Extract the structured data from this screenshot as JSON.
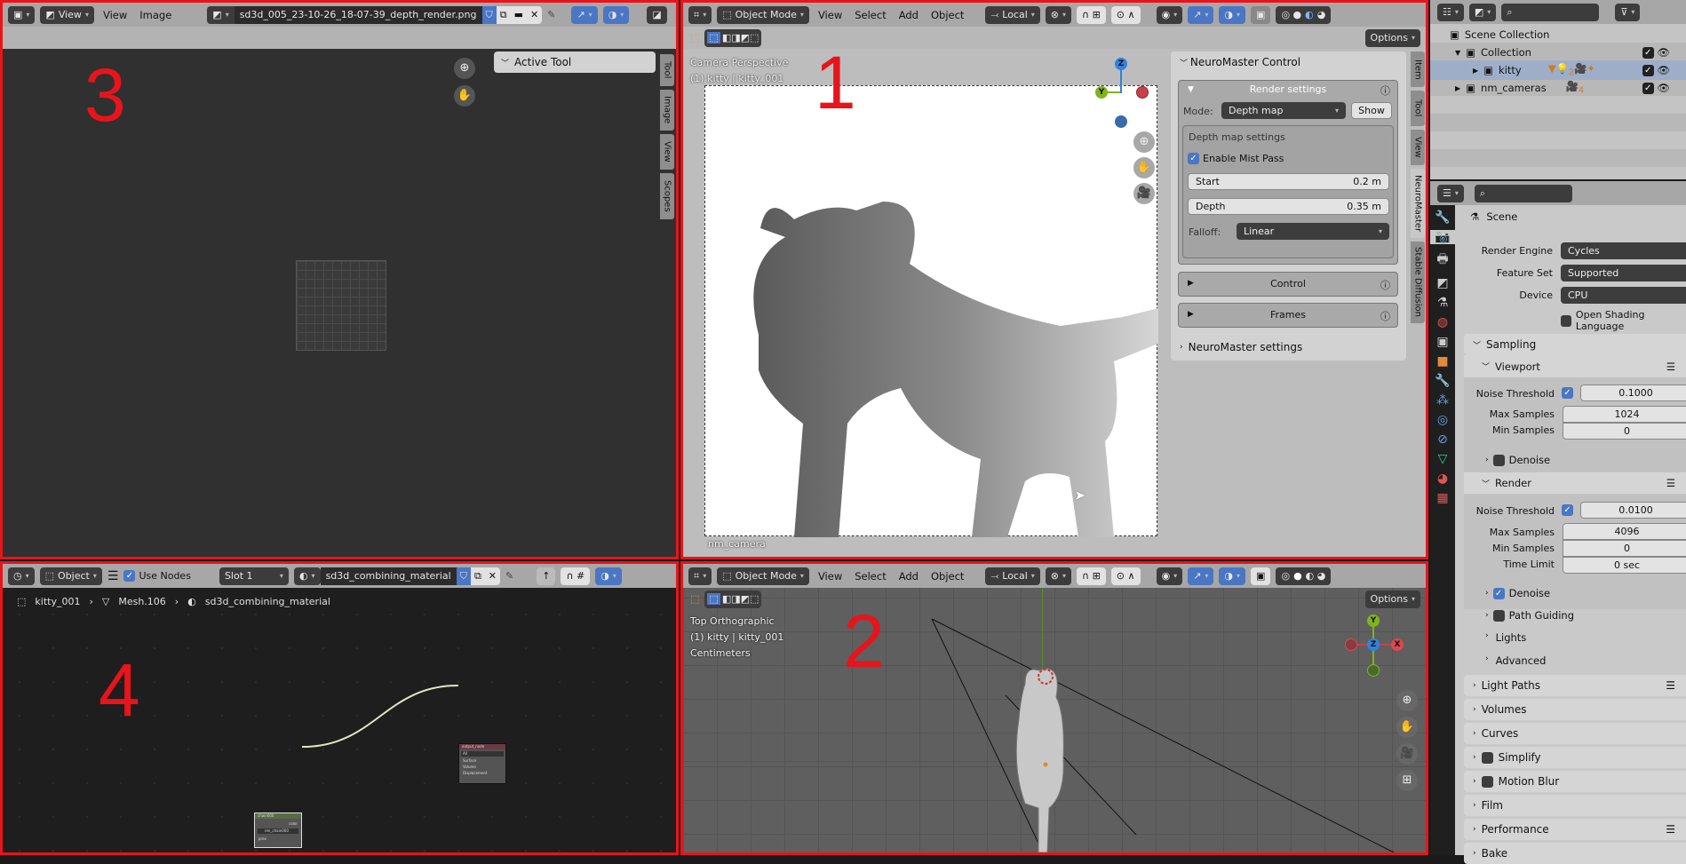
{
  "annotations": {
    "area1": "1",
    "area2": "2",
    "area3": "3",
    "area4": "4"
  },
  "image_editor": {
    "view_label": "View",
    "menus": [
      "View",
      "Image"
    ],
    "image_name": "sd3d_005_23-10-26_18-07-39_depth_render.png",
    "active_tool_title": "Active Tool",
    "side_tabs": [
      "Tool",
      "Image",
      "View",
      "Scopes"
    ]
  },
  "viewport_camera": {
    "mode": "Object Mode",
    "menus": [
      "View",
      "Select",
      "Add",
      "Object"
    ],
    "orientation": "Local",
    "options": "Options",
    "overlay_line1": "Camera Perspective",
    "overlay_line2": "(1) kitty | kitty_001",
    "camera_name": "nm_camera",
    "gizmo": {
      "z": "Z",
      "y": "Y"
    },
    "side_tabs": [
      "Item",
      "Tool",
      "View",
      "NeuroMaster",
      "Stable Diffusion"
    ],
    "neuromaster": {
      "title": "NeuroMaster Control",
      "render_settings": "Render settings",
      "mode_label": "Mode:",
      "mode_value": "Depth map",
      "show_button": "Show",
      "depth_settings": "Depth map settings",
      "enable_mist": "Enable Mist Pass",
      "enable_mist_checked": true,
      "start_label": "Start",
      "start_value": "0.2 m",
      "depth_label": "Depth",
      "depth_value": "0.35 m",
      "falloff_label": "Falloff:",
      "falloff_value": "Linear",
      "control": "Control",
      "frames": "Frames",
      "settings": "NeuroMaster settings"
    }
  },
  "viewport_top": {
    "mode": "Object Mode",
    "menus": [
      "View",
      "Select",
      "Add",
      "Object"
    ],
    "orientation": "Local",
    "options": "Options",
    "overlay_line1": "Top Orthographic",
    "overlay_line2": "(1) kitty | kitty_001",
    "overlay_line3": "Centimeters",
    "gizmo": {
      "y": "Y",
      "z": "Z",
      "x": "X"
    }
  },
  "node_editor": {
    "object_mode": "Object",
    "use_nodes": "Use Nodes",
    "use_nodes_checked": true,
    "slot": "Slot 1",
    "material": "sd3d_combining_material",
    "breadcrumb": [
      "kitty_001",
      "Mesh.106",
      "sd3d_combining_material"
    ],
    "output_node": {
      "title": "output_node",
      "target": "All",
      "sockets": [
        "Surface",
        "Volume",
        "Displacement"
      ]
    },
    "chain_node": {
      "title": "chain000",
      "output": "color",
      "group": "nm_chain000",
      "input": "prev"
    }
  },
  "outliner": {
    "root": "Scene Collection",
    "items": [
      {
        "name": "Collection",
        "depth": 1
      },
      {
        "name": "kitty",
        "depth": 2,
        "selected": true,
        "badge_light_count": "2"
      },
      {
        "name": "nm_cameras",
        "depth": 1,
        "badge_camera_count": "4"
      }
    ]
  },
  "properties": {
    "context": "Scene",
    "render_engine_label": "Render Engine",
    "render_engine": "Cycles",
    "feature_set_label": "Feature Set",
    "feature_set": "Supported",
    "device_label": "Device",
    "device": "CPU",
    "osl_label": "Open Shading Language",
    "sampling": "Sampling",
    "viewport": {
      "title": "Viewport",
      "noise_label": "Noise Threshold",
      "noise": "0.1000",
      "max_label": "Max Samples",
      "max": "1024",
      "min_label": "Min Samples",
      "min": "0",
      "denoise": "Denoise"
    },
    "render": {
      "title": "Render",
      "noise_label": "Noise Threshold",
      "noise": "0.0100",
      "max_label": "Max Samples",
      "max": "4096",
      "min_label": "Min Samples",
      "min": "0",
      "time_label": "Time Limit",
      "time": "0 sec",
      "denoise": "Denoise"
    },
    "sub_sections": [
      "Path Guiding",
      "Lights",
      "Advanced"
    ],
    "sections": [
      "Light Paths",
      "Volumes",
      "Curves",
      "Simplify",
      "Motion Blur",
      "Film",
      "Performance",
      "Bake"
    ]
  },
  "colors": {
    "annotation": "#e8141c",
    "accent": "#4a76c4",
    "x_axis": "#e0464f",
    "y_axis": "#7fb517",
    "z_axis": "#2f83e0"
  }
}
